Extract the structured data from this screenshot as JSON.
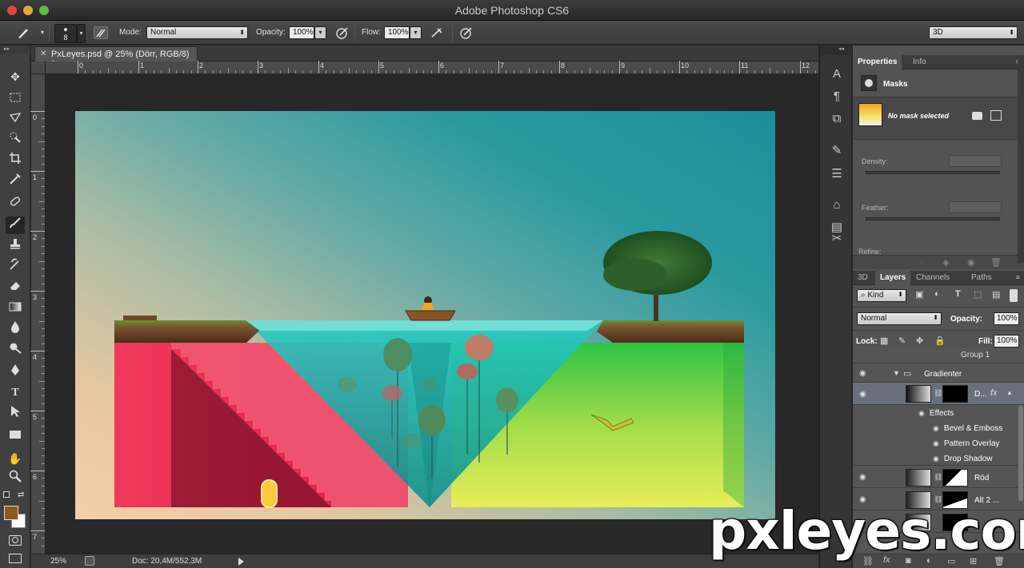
{
  "app": {
    "title": "Adobe Photoshop CS6"
  },
  "options": {
    "brush_size": "8",
    "mode_label": "Mode:",
    "mode_value": "Normal",
    "opacity_label": "Opacity:",
    "opacity_value": "100%",
    "flow_label": "Flow:",
    "flow_value": "100%",
    "workspace_value": "3D"
  },
  "document": {
    "tab_title": "PxLeyes.psd @ 25% (Dörr, RGB/8) *",
    "ruler_h": [
      "0",
      "1",
      "2",
      "3",
      "4",
      "5",
      "6",
      "7",
      "8",
      "9",
      "10",
      "11",
      "12"
    ],
    "ruler_v": [
      "0",
      "1",
      "2",
      "3",
      "4",
      "5",
      "6",
      "7"
    ]
  },
  "status": {
    "zoom": "25%",
    "doc": "Doc: 20,4M/552,3M"
  },
  "properties": {
    "tabs": [
      "Properties",
      "Info"
    ],
    "section": "Masks",
    "mask_state": "No mask selected",
    "density_label": "Density:",
    "feather_label": "Feather:",
    "refine_label": "Refine:"
  },
  "layers_panel": {
    "tabs": [
      "3D",
      "Layers",
      "Channels",
      "Paths"
    ],
    "kind_label": "Kind",
    "blend_mode": "Normal",
    "opacity_label": "Opacity:",
    "opacity_value": "100%",
    "lock_label": "Lock:",
    "fill_label": "Fill:",
    "fill_value": "100%",
    "layers": {
      "group1": "Group 1",
      "gradienter": "Gradienter",
      "selected": "D...",
      "effects": "Effects",
      "bevel": "Bevel & Emboss",
      "pattern": "Pattern Overlay",
      "shadow": "Drop Shadow",
      "rod": "Röd",
      "alt2": "Alt 2 ..."
    }
  },
  "watermark": "pxleyes.com",
  "colors": {
    "foreground": "#8a5a1e",
    "background": "#ffffff",
    "accent_red": "#e8294e",
    "accent_teal": "#1fb7b4",
    "accent_green": "#37c24a"
  }
}
